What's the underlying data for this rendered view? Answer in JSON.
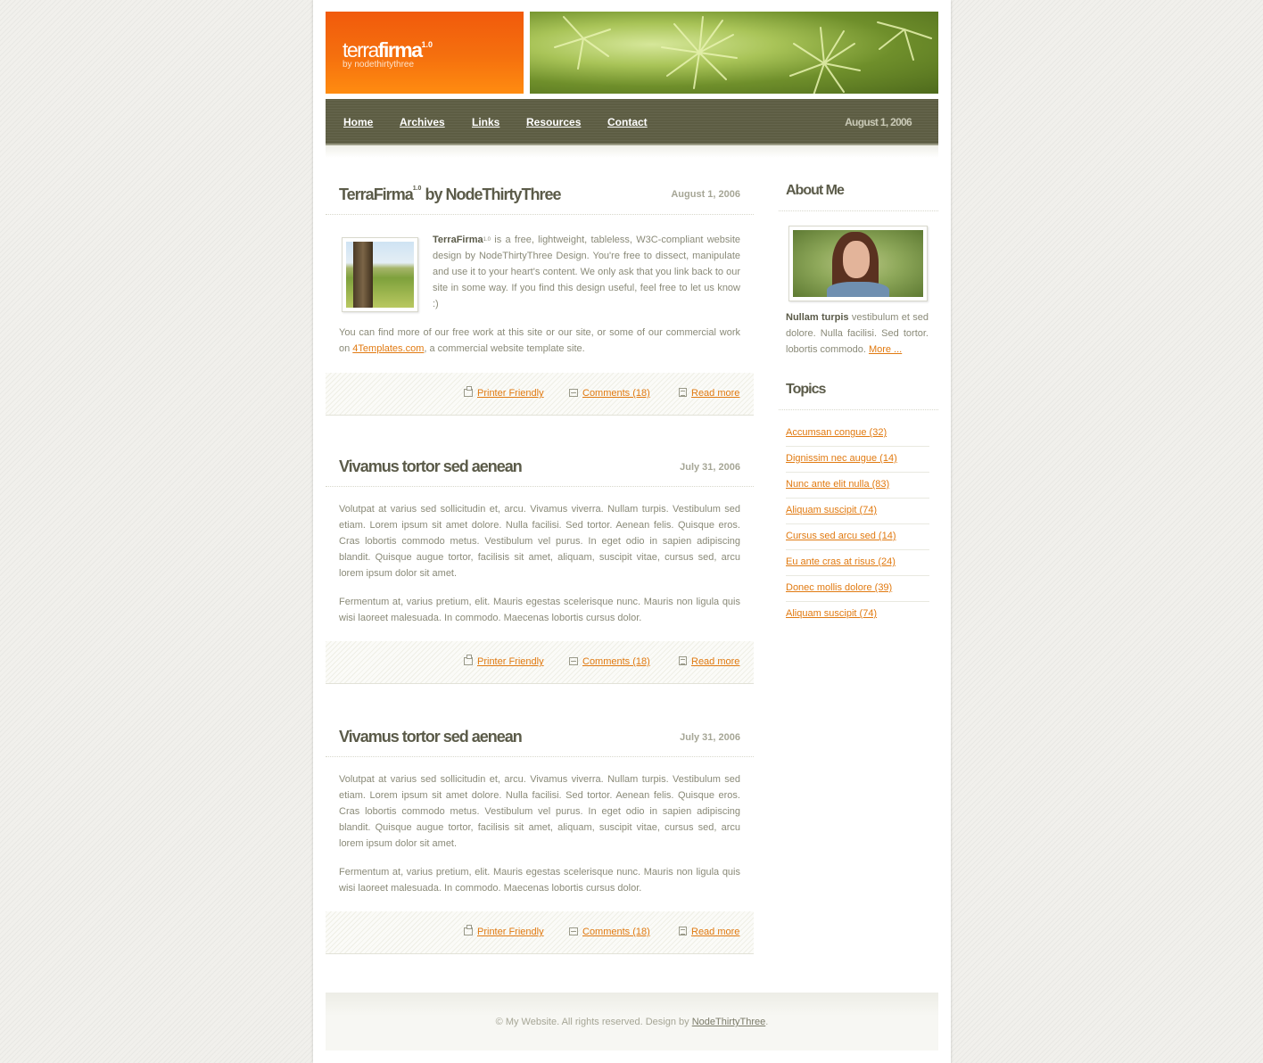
{
  "header": {
    "logo": {
      "light": "terra",
      "bold": "firma",
      "version": "1.0",
      "subtitle": "by nodethirtythree"
    }
  },
  "nav": {
    "items": [
      {
        "label": "Home"
      },
      {
        "label": "Archives"
      },
      {
        "label": "Links"
      },
      {
        "label": "Resources"
      },
      {
        "label": "Contact"
      }
    ],
    "date": "August 1, 2006"
  },
  "posts": [
    {
      "title_main": "TerraFirma",
      "title_sup": "1.0",
      "title_rest": " by NodeThirtyThree",
      "date": "August 1, 2006",
      "intro_bold": "TerraFirma",
      "intro_sup": "1.0",
      "intro_text": " is a free, lightweight, tableless, W3C-compliant website design by NodeThirtyThree Design. You're free to dissect, manipulate and use it to your heart's content. We only ask that you link back to our site in some way. If you find this design useful, feel free to let us know :)",
      "para2_before": "You can find more of our free work at this site or our site, or some of our commercial work on ",
      "para2_link": "4Templates.com",
      "para2_after": ", a commercial website template site.",
      "footer": {
        "printer": "Printer Friendly",
        "comments": "Comments (18)",
        "read_more": "Read more"
      }
    },
    {
      "title": "Vivamus tortor sed aenean",
      "date": "July 31, 2006",
      "para1": "Volutpat at varius sed sollicitudin et, arcu. Vivamus viverra. Nullam turpis. Vestibulum sed etiam. Lorem ipsum sit amet dolore. Nulla facilisi. Sed tortor. Aenean felis. Quisque eros. Cras lobortis commodo metus. Vestibulum vel purus. In eget odio in sapien adipiscing blandit. Quisque augue tortor, facilisis sit amet, aliquam, suscipit vitae, cursus sed, arcu lorem ipsum dolor sit amet.",
      "para2": "Fermentum at, varius pretium, elit. Mauris egestas scelerisque nunc. Mauris non ligula quis wisi laoreet malesuada. In commodo. Maecenas lobortis cursus dolor.",
      "footer": {
        "printer": "Printer Friendly",
        "comments": "Comments (18)",
        "read_more": "Read more"
      }
    },
    {
      "title": "Vivamus tortor sed aenean",
      "date": "July 31, 2006",
      "para1": "Volutpat at varius sed sollicitudin et, arcu. Vivamus viverra. Nullam turpis. Vestibulum sed etiam. Lorem ipsum sit amet dolore. Nulla facilisi. Sed tortor. Aenean felis. Quisque eros. Cras lobortis commodo metus. Vestibulum vel purus. In eget odio in sapien adipiscing blandit. Quisque augue tortor, facilisis sit amet, aliquam, suscipit vitae, cursus sed, arcu lorem ipsum dolor sit amet.",
      "para2": "Fermentum at, varius pretium, elit. Mauris egestas scelerisque nunc. Mauris non ligula quis wisi laoreet malesuada. In commodo. Maecenas lobortis cursus dolor.",
      "footer": {
        "printer": "Printer Friendly",
        "comments": "Comments (18)",
        "read_more": "Read more"
      }
    }
  ],
  "sidebar": {
    "about": {
      "title": "About Me",
      "bold": "Nullam turpis",
      "text": " vestibulum et sed dolore. Nulla facilisi. Sed tortor. lobortis commodo. ",
      "more": "More ..."
    },
    "topics": {
      "title": "Topics",
      "items": [
        "Accumsan congue (32)",
        "Dignissim nec augue (14)",
        "Nunc ante elit nulla (83)",
        "Aliquam suscipit (74)",
        "Cursus sed arcu sed (14)",
        "Eu ante cras at risus (24)",
        "Donec mollis dolore (39)",
        "Aliquam suscipit (74)"
      ]
    }
  },
  "footer": {
    "text": "© My Website. All rights reserved. Design by ",
    "link": "NodeThirtyThree",
    "end": "."
  },
  "colors": {
    "accent": "#e17a11",
    "logo_orange": "#f5700e",
    "nav_olive": "#5d5d43",
    "heading": "#5b5b49"
  }
}
